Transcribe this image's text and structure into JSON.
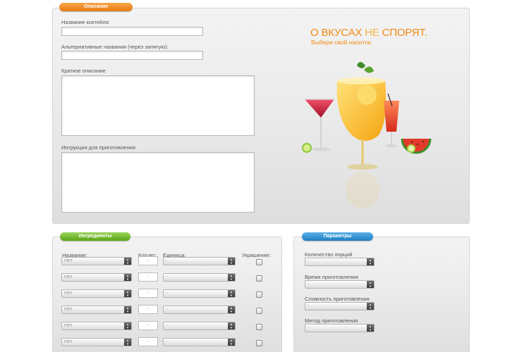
{
  "description": {
    "title": "Описание",
    "name_label": "Название коктейля:",
    "alt_names_label": "Альтернативные названия (через запятую):",
    "short_desc_label": "Краткое описание",
    "instructions_label": "Интрукция для приготовления"
  },
  "promo": {
    "slogan_part1": "О ",
    "slogan_part2": "ВКУСАХ ",
    "slogan_part3": "НЕ ",
    "slogan_part4": "СПОРЯТ.",
    "subtitle": "Выбери свой напиток."
  },
  "ingredients": {
    "title": "Ингредиенты",
    "col_name": "Название:",
    "col_qty": "Кол-во:",
    "col_unit": "Единица:",
    "col_garnish": "Украшение:",
    "rows": [
      {
        "name": "Нет",
        "qty": "-",
        "unit": "-"
      },
      {
        "name": "Нет",
        "qty": "-",
        "unit": "-"
      },
      {
        "name": "Нет",
        "qty": "-",
        "unit": "-"
      },
      {
        "name": "Нет",
        "qty": "-",
        "unit": "-"
      },
      {
        "name": "Нет",
        "qty": "-",
        "unit": "-"
      },
      {
        "name": "Нет",
        "qty": "-",
        "unit": "-"
      }
    ]
  },
  "params": {
    "title": "Параметры",
    "servings_label": "Количество порций",
    "servings_value": "-",
    "time_label": "Время приготовления",
    "time_value": "-",
    "difficulty_label": "Сложность приготовления",
    "difficulty_value": "-",
    "method_label": "Метод приготовления",
    "method_value": "-"
  },
  "colors": {
    "accent_orange": "#f08a14",
    "pill_orange": "#e87b0e",
    "pill_green": "#5aa517",
    "pill_blue": "#1f7fc2"
  }
}
